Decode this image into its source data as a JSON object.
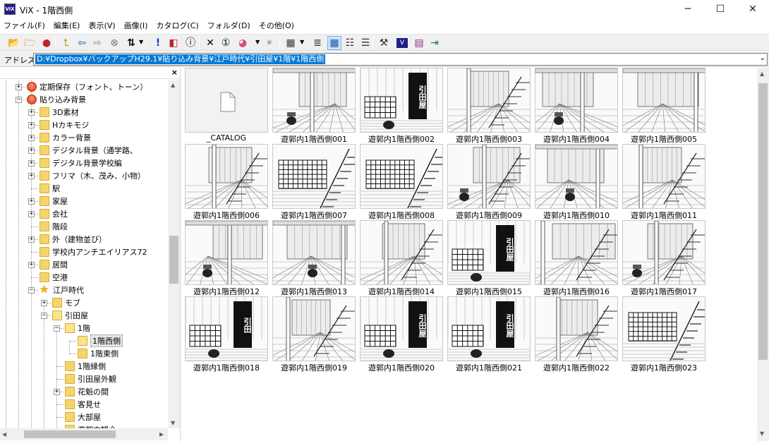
{
  "window": {
    "title": "ViX - 1階西側",
    "app_icon_label": "ViX",
    "minimize_icon": "minimize-icon",
    "maximize_icon": "maximize-icon",
    "close_icon": "close-icon"
  },
  "menu": [
    {
      "label": "ファイル(F)"
    },
    {
      "label": "編集(E)"
    },
    {
      "label": "表示(V)"
    },
    {
      "label": "画像(I)"
    },
    {
      "label": "カタログ(C)"
    },
    {
      "label": "フォルダ(D)"
    },
    {
      "label": "その他(O)"
    }
  ],
  "toolbar": {
    "buttons": [
      {
        "name": "open-folder-icon",
        "glyph": "📂"
      },
      {
        "name": "new-folder-icon",
        "glyph": "🗁"
      },
      {
        "name": "bookmark-icon",
        "glyph": "●"
      },
      {
        "name": "up-folder-icon",
        "glyph": "⮤"
      },
      {
        "name": "back-arrow-icon",
        "glyph": "⇦"
      },
      {
        "name": "forward-arrow-icon",
        "glyph": "⇨"
      },
      {
        "name": "stop-icon",
        "glyph": "⊗"
      },
      {
        "name": "sort-icon",
        "glyph": "⇅"
      },
      {
        "name": "alert-icon",
        "glyph": "!"
      },
      {
        "name": "window-icon",
        "glyph": "◧"
      },
      {
        "name": "info-icon",
        "glyph": "ⓘ"
      },
      {
        "name": "delete-icon",
        "glyph": "✕"
      },
      {
        "name": "properties-icon",
        "glyph": "①"
      },
      {
        "name": "color-icon",
        "glyph": "◕"
      },
      {
        "name": "slideshow-icon",
        "glyph": "✴"
      },
      {
        "name": "view-mode-icon",
        "glyph": "▦"
      },
      {
        "name": "list-view-icon",
        "glyph": "≣"
      },
      {
        "name": "large-icons-view-icon",
        "glyph": "▦"
      },
      {
        "name": "small-icons-view-icon",
        "glyph": "☷"
      },
      {
        "name": "details-view-icon",
        "glyph": "☰"
      },
      {
        "name": "tools-icon",
        "glyph": "⚒"
      },
      {
        "name": "vix-logo-icon",
        "glyph": "V"
      },
      {
        "name": "catalog-book-icon",
        "glyph": "▤"
      },
      {
        "name": "exit-icon",
        "glyph": "⇥"
      }
    ]
  },
  "address": {
    "label": "アドレス",
    "path": "D:¥Dropbox¥バックアップH29.1¥貼り込み背景¥江戸時代¥引田屋¥1階¥1階西側"
  },
  "tree": {
    "close_glyph": "×",
    "nodes": [
      {
        "label": "定期保存（フォント、トーン）",
        "level": 3,
        "icon": "special",
        "exp": "+"
      },
      {
        "label": "貼り込み背景",
        "level": 3,
        "icon": "special",
        "exp": "-"
      },
      {
        "label": "3D素材",
        "level": 4,
        "icon": "folder",
        "exp": "+"
      },
      {
        "label": "Hカキモジ",
        "level": 4,
        "icon": "folder",
        "exp": "+"
      },
      {
        "label": "カラー背景",
        "level": 4,
        "icon": "folder",
        "exp": "+"
      },
      {
        "label": "デジタル背景（通学路、",
        "level": 4,
        "icon": "folder",
        "exp": "+"
      },
      {
        "label": "デジタル背景学校編",
        "level": 4,
        "icon": "folder",
        "exp": "+"
      },
      {
        "label": "フリマ（木、茂み、小物）",
        "level": 4,
        "icon": "folder",
        "exp": "+"
      },
      {
        "label": "駅",
        "level": 4,
        "icon": "folder",
        "exp": ""
      },
      {
        "label": "家屋",
        "level": 4,
        "icon": "folder",
        "exp": "+"
      },
      {
        "label": "会社",
        "level": 4,
        "icon": "folder",
        "exp": "+"
      },
      {
        "label": "階段",
        "level": 4,
        "icon": "folder",
        "exp": ""
      },
      {
        "label": "外（建物並び）",
        "level": 4,
        "icon": "folder",
        "exp": "+"
      },
      {
        "label": "学校内アンチエイリアス72",
        "level": 4,
        "icon": "folder",
        "exp": ""
      },
      {
        "label": "居間",
        "level": 4,
        "icon": "folder",
        "exp": "+"
      },
      {
        "label": "空港",
        "level": 4,
        "icon": "folder",
        "exp": ""
      },
      {
        "label": "江戸時代",
        "level": 4,
        "icon": "star",
        "exp": "-"
      },
      {
        "label": "モブ",
        "level": 5,
        "icon": "folder",
        "exp": "+"
      },
      {
        "label": "引田屋",
        "level": 5,
        "icon": "folder",
        "exp": "-"
      },
      {
        "label": "1階",
        "level": 6,
        "icon": "folder",
        "exp": "-"
      },
      {
        "label": "1階西側",
        "level": 7,
        "icon": "folder",
        "exp": "",
        "selected": true
      },
      {
        "label": "1階東側",
        "level": 7,
        "icon": "folder",
        "exp": ""
      },
      {
        "label": "1階縁側",
        "level": 6,
        "icon": "folder",
        "exp": ""
      },
      {
        "label": "引田屋外観",
        "level": 6,
        "icon": "folder",
        "exp": ""
      },
      {
        "label": "花魁の間",
        "level": 6,
        "icon": "folder",
        "exp": "+"
      },
      {
        "label": "客見せ",
        "level": 6,
        "icon": "folder",
        "exp": ""
      },
      {
        "label": "大部屋",
        "level": 6,
        "icon": "folder",
        "exp": ""
      },
      {
        "label": "遊郭内観全",
        "level": 6,
        "icon": "folder",
        "exp": ""
      }
    ]
  },
  "thumbnails": [
    {
      "label": "_CATALOG",
      "kind": "file"
    },
    {
      "label": "遊郭内1階西側001",
      "kind": "scene"
    },
    {
      "label": "遊郭内1階西側002",
      "kind": "sign",
      "sign": "引田屋"
    },
    {
      "label": "遊郭内1階西側003",
      "kind": "scene"
    },
    {
      "label": "遊郭内1階西側004",
      "kind": "scene"
    },
    {
      "label": "遊郭内1階西側005",
      "kind": "scene"
    },
    {
      "label": "遊郭内1階西側006",
      "kind": "scene"
    },
    {
      "label": "遊郭内1階西側007",
      "kind": "lattice"
    },
    {
      "label": "遊郭内1階西側008",
      "kind": "lattice"
    },
    {
      "label": "遊郭内1階西側009",
      "kind": "scene"
    },
    {
      "label": "遊郭内1階西側010",
      "kind": "scene"
    },
    {
      "label": "遊郭内1階西側011",
      "kind": "scene"
    },
    {
      "label": "遊郭内1階西側012",
      "kind": "scene"
    },
    {
      "label": "遊郭内1階西側013",
      "kind": "scene"
    },
    {
      "label": "遊郭内1階西側014",
      "kind": "scene"
    },
    {
      "label": "遊郭内1階西側015",
      "kind": "sign",
      "sign": "引田屋"
    },
    {
      "label": "遊郭内1階西側016",
      "kind": "scene"
    },
    {
      "label": "遊郭内1階西側017",
      "kind": "scene"
    },
    {
      "label": "遊郭内1階西側018",
      "kind": "sign",
      "sign": "引田"
    },
    {
      "label": "遊郭内1階西側019",
      "kind": "scene"
    },
    {
      "label": "遊郭内1階西側020",
      "kind": "sign",
      "sign": "引田屋"
    },
    {
      "label": "遊郭内1階西側021",
      "kind": "sign",
      "sign": "引田屋"
    },
    {
      "label": "遊郭内1階西側022",
      "kind": "scene"
    },
    {
      "label": "遊郭内1階西側023",
      "kind": "lattice"
    }
  ]
}
